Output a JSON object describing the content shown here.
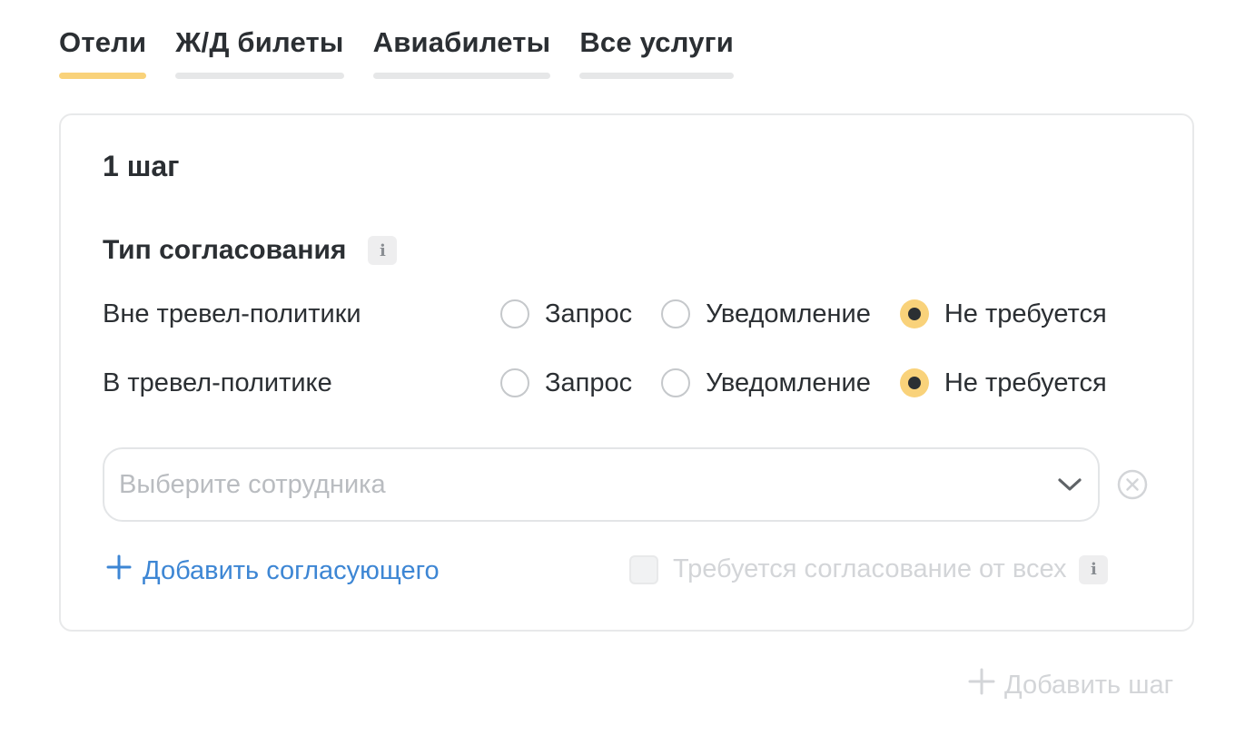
{
  "tabs": [
    {
      "label": "Отели",
      "active": true
    },
    {
      "label": "Ж/Д билеты",
      "active": false
    },
    {
      "label": "Авиабилеты",
      "active": false
    },
    {
      "label": "Все услуги",
      "active": false
    }
  ],
  "step": {
    "title": "1 шаг",
    "approval_type": {
      "title": "Тип согласования",
      "info_icon": "i",
      "rows": [
        {
          "label": "Вне тревел-политики",
          "options": [
            "Запрос",
            "Уведомление",
            "Не требуется"
          ],
          "selected": "Не требуется"
        },
        {
          "label": "В тревел-политике",
          "options": [
            "Запрос",
            "Уведомление",
            "Не требуется"
          ],
          "selected": "Не требуется"
        }
      ]
    },
    "employee_select": {
      "placeholder": "Выберите сотрудника",
      "value": ""
    },
    "add_approver_label": "Добавить согласующего",
    "require_all": {
      "label": "Требуется согласование от всех",
      "checked": false,
      "disabled": true,
      "info_icon": "i"
    }
  },
  "add_step_label": "Добавить шаг",
  "colors": {
    "accent": "#f9d27a",
    "link": "#3d86d4",
    "text": "#2b2f33",
    "disabled": "#d3d5d8",
    "border": "#e8e9ea"
  }
}
